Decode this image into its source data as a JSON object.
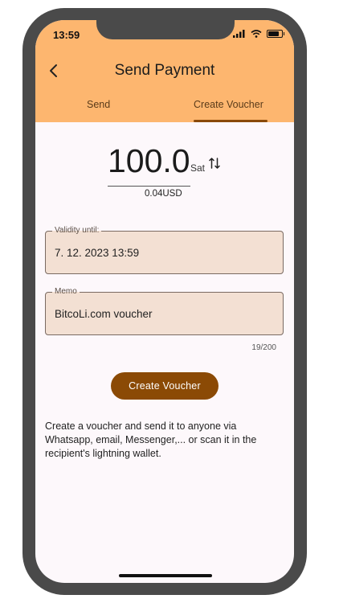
{
  "status_bar": {
    "time": "13:59",
    "icons": [
      "signal-icon",
      "wifi-icon",
      "battery-icon"
    ]
  },
  "header": {
    "title": "Send Payment",
    "back_icon": "chevron-left-icon"
  },
  "tabs": [
    {
      "label": "Send",
      "active": false
    },
    {
      "label": "Create Voucher",
      "active": true
    }
  ],
  "amount": {
    "value": "100.0",
    "unit": "Sat",
    "fiat": "0.04USD",
    "swap_icon": "swap-vertical-icon"
  },
  "validity": {
    "label": "Validity until:",
    "value": "7. 12. 2023 13:59"
  },
  "memo": {
    "label": "Memo",
    "value": "BitcoLi.com voucher",
    "counter": "19/200"
  },
  "create_button": {
    "label": "Create Voucher"
  },
  "description": "Create a voucher and send it to anyone via Whatsapp, email, Messenger,... or scan it in the recipient's lightning wallet.",
  "colors": {
    "header": "#fdb66f",
    "accent": "#8b4a05",
    "field_bg": "#f3e0d3",
    "background": "#fdf8fb"
  }
}
